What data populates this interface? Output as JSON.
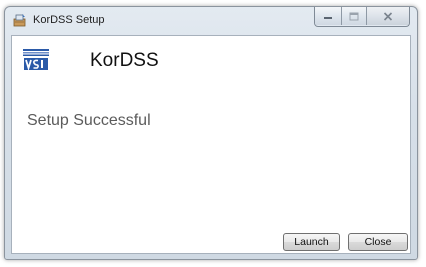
{
  "window": {
    "title": "KorDSS Setup"
  },
  "header": {
    "product_name": "KorDSS",
    "logo_icon": "vsi-logo-icon"
  },
  "main": {
    "status": "Setup Successful"
  },
  "buttons": {
    "launch": "Launch",
    "close": "Close"
  },
  "titlebar_icons": {
    "app": "setup-icon",
    "minimize": "minimize-icon",
    "maximize": "maximize-icon",
    "close": "close-icon"
  },
  "colors": {
    "logo_blue": "#2b5aa8",
    "text_primary": "#111111",
    "status_text": "#5b5b5b"
  }
}
